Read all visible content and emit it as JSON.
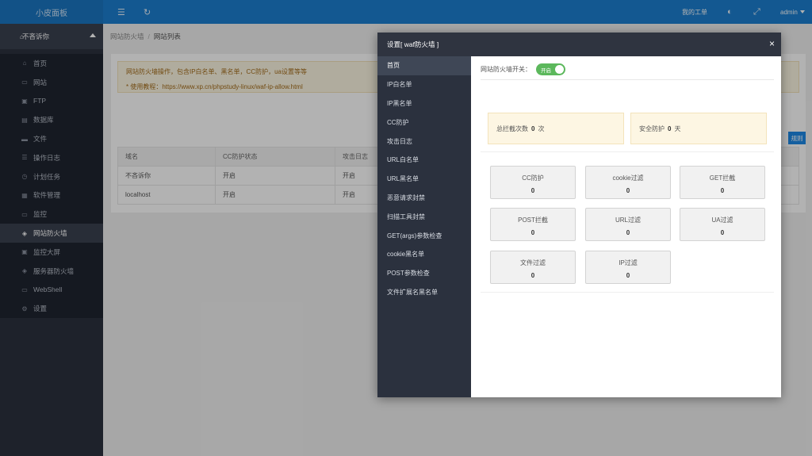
{
  "app": {
    "brand": "小皮面板"
  },
  "topbar": {
    "menu_icon": "☰",
    "refresh_icon": "↻",
    "tickets": "我的工单",
    "skin_icon": "◐",
    "fullscreen_icon": "⤢",
    "user": "admin"
  },
  "sidebar": {
    "current_site": "不吝诉你",
    "items": [
      {
        "label": "首页",
        "icon": "⌂"
      },
      {
        "label": "网站",
        "icon": "▭"
      },
      {
        "label": "FTP",
        "icon": "▣"
      },
      {
        "label": "数据库",
        "icon": "▤"
      },
      {
        "label": "文件",
        "icon": "▬"
      },
      {
        "label": "操作日志",
        "icon": "☰"
      },
      {
        "label": "计划任务",
        "icon": "◷"
      },
      {
        "label": "软件管理",
        "icon": "▦"
      },
      {
        "label": "监控",
        "icon": "▭"
      },
      {
        "label": "网站防火墙",
        "icon": "◈"
      },
      {
        "label": "监控大屏",
        "icon": "▣"
      },
      {
        "label": "服务器防火墙",
        "icon": "◈"
      },
      {
        "label": "WebShell",
        "icon": "▭"
      },
      {
        "label": "设置",
        "icon": "⚙"
      }
    ]
  },
  "breadcrumb": {
    "parent": "网站防火墙",
    "separator": "/",
    "current": "网站列表"
  },
  "notice": {
    "line1": "网站防火墙操作，包含IP白名单、黑名单，CC防护，ua设置等等",
    "line2": "* 使用教程：https://www.xp.cn/phpstudy-linux/waf-ip-allow.html"
  },
  "add_rule_button": "规则",
  "site_table": {
    "columns": [
      "域名",
      "CC防护状态",
      "攻击日志"
    ],
    "rows": [
      [
        "不吝诉你",
        "开启",
        "开启"
      ],
      [
        "localhost",
        "开启",
        "开启"
      ]
    ]
  },
  "modal": {
    "title": "设置[ waf防火墙 ]",
    "close_label": "×",
    "tabs": [
      "首页",
      "IP白名单",
      "IP黑名单",
      "CC防护",
      "攻击日志",
      "URL白名单",
      "URL黑名单",
      "恶意请求封禁",
      "扫描工具封禁",
      "GET(args)参数检查",
      "cookie黑名单",
      "POST参数检查",
      "文件扩展名黑名单"
    ],
    "switch_label": "网站防火墙开关：",
    "switch_text": "开启",
    "switch_on": true,
    "stats": {
      "total_prefix": "总拦截次数",
      "total_value": "0",
      "total_unit": "次",
      "days_prefix": "安全防护",
      "days_value": "0",
      "days_unit": "天"
    },
    "filters": [
      {
        "label": "CC防护",
        "count": "0"
      },
      {
        "label": "cookie过滤",
        "count": "0"
      },
      {
        "label": "GET拦截",
        "count": "0"
      },
      {
        "label": "POST拦截",
        "count": "0"
      },
      {
        "label": "URL过滤",
        "count": "0"
      },
      {
        "label": "UA过滤",
        "count": "0"
      },
      {
        "label": "文件过滤",
        "count": "0"
      },
      {
        "label": "IP过滤",
        "count": "0"
      }
    ]
  }
}
